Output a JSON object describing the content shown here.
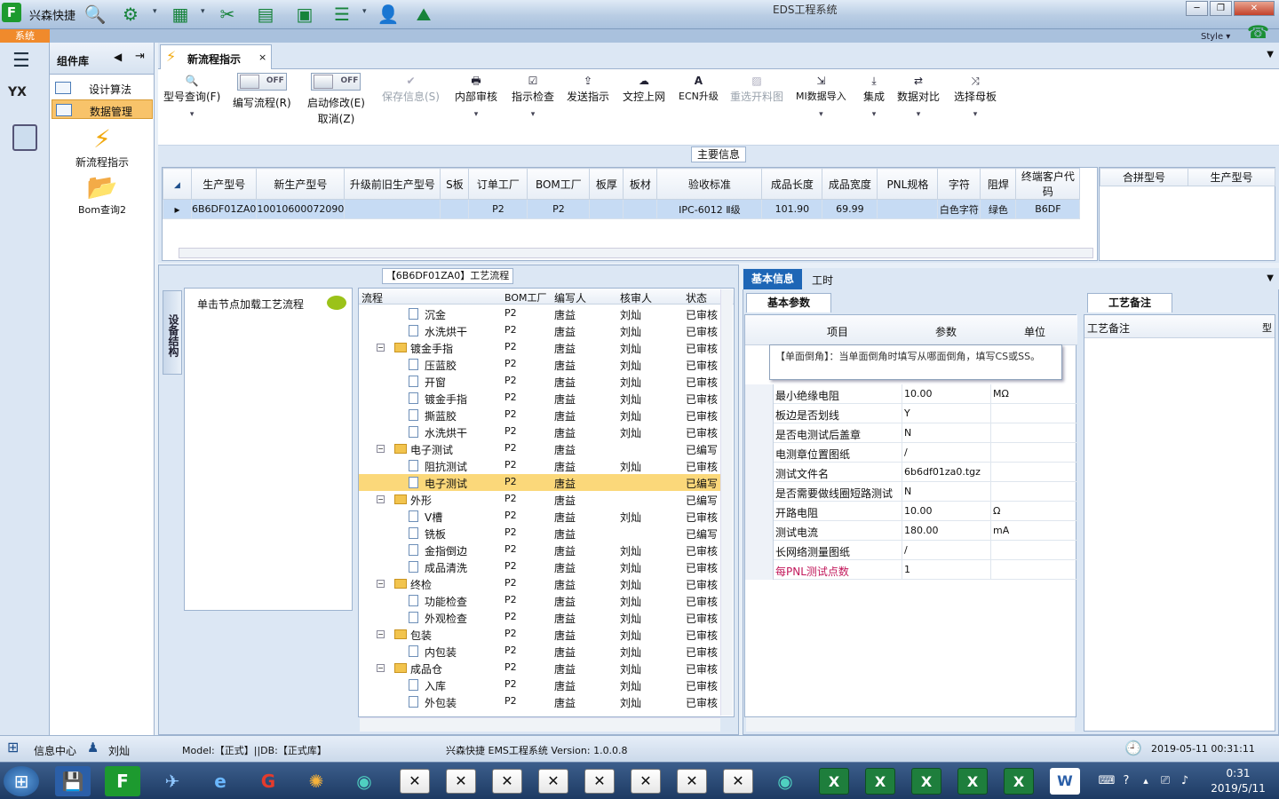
{
  "titlebar": {
    "app_name": "兴森快捷",
    "window_title": "EDS工程系统",
    "min": "─",
    "max": "❐",
    "close": "✕"
  },
  "ribbon": {
    "system_tab": "系统",
    "style_label": "Style ▾"
  },
  "component_panel": {
    "title": "组件库",
    "items": [
      {
        "label": "设计算法"
      },
      {
        "label": "数据管理"
      }
    ],
    "big_items": [
      {
        "label": "新流程指示"
      },
      {
        "label": "Bom查询2"
      }
    ]
  },
  "doc_tab": {
    "label": "新流程指示",
    "close": "×"
  },
  "toolbar": {
    "model_query": "型号查询(F)",
    "toggle_off": "OFF",
    "write_flow": "编写流程(R)",
    "start_modify": "启动修改(E)",
    "cancel": "取消(Z)",
    "save_info": "保存信息(S)",
    "internal_review": "内部审核",
    "instruction_check": "指示检查",
    "send_instruction": "发送指示",
    "doc_upload": "文控上网",
    "ecn_upgrade": "ECN升级",
    "reselect_material": "重选开料图",
    "mi_import": "MI数据导入",
    "integrate": "集成",
    "data_compare": "数据对比",
    "select_mother": "选择母板"
  },
  "main_info": {
    "caption": "主要信息",
    "columns": [
      "生产型号",
      "新生产型号",
      "升级前旧生产型号",
      "S板",
      "订单工厂",
      "BOM工厂",
      "板厚",
      "板材",
      "验收标准",
      "成品长度",
      "成品宽度",
      "PNL规格",
      "字符",
      "阻焊",
      "终端客户代码"
    ],
    "row": [
      "6B6DF01ZA0",
      "10010600072090",
      "",
      "",
      "P2",
      "P2",
      "",
      "",
      "IPC-6012 Ⅱ级",
      "101.90",
      "69.99",
      "",
      "白色字符",
      "绿色",
      "B6DF"
    ],
    "side_columns": [
      "合拼型号",
      "生产型号"
    ]
  },
  "process": {
    "caption": "【6B6DF01ZA0】工艺流程",
    "side_tab": "设备结构",
    "hint": "单击节点加载工艺流程",
    "columns": [
      "流程",
      "BOM工厂",
      "编写人",
      "核审人",
      "状态"
    ],
    "rows": [
      {
        "name": "沉金",
        "level": 2,
        "bom": "P2",
        "writer": "唐益",
        "reviewer": "刘灿",
        "status": "已审核"
      },
      {
        "name": "水洗烘干",
        "level": 2,
        "bom": "P2",
        "writer": "唐益",
        "reviewer": "刘灿",
        "status": "已审核"
      },
      {
        "name": "镀金手指",
        "level": 1,
        "bom": "P2",
        "writer": "唐益",
        "reviewer": "刘灿",
        "status": "已审核"
      },
      {
        "name": "压蓝胶",
        "level": 2,
        "bom": "P2",
        "writer": "唐益",
        "reviewer": "刘灿",
        "status": "已审核"
      },
      {
        "name": "开窗",
        "level": 2,
        "bom": "P2",
        "writer": "唐益",
        "reviewer": "刘灿",
        "status": "已审核"
      },
      {
        "name": "镀金手指",
        "level": 2,
        "bom": "P2",
        "writer": "唐益",
        "reviewer": "刘灿",
        "status": "已审核"
      },
      {
        "name": "撕蓝胶",
        "level": 2,
        "bom": "P2",
        "writer": "唐益",
        "reviewer": "刘灿",
        "status": "已审核"
      },
      {
        "name": "水洗烘干",
        "level": 2,
        "bom": "P2",
        "writer": "唐益",
        "reviewer": "刘灿",
        "status": "已审核"
      },
      {
        "name": "电子测试",
        "level": 1,
        "bom": "P2",
        "writer": "唐益",
        "reviewer": "",
        "status": "已编写"
      },
      {
        "name": "阻抗测试",
        "level": 2,
        "bom": "P2",
        "writer": "唐益",
        "reviewer": "刘灿",
        "status": "已审核"
      },
      {
        "name": "电子测试",
        "level": 2,
        "bom": "P2",
        "writer": "唐益",
        "reviewer": "",
        "status": "已编写",
        "selected": true
      },
      {
        "name": "外形",
        "level": 1,
        "bom": "P2",
        "writer": "唐益",
        "reviewer": "",
        "status": "已编写"
      },
      {
        "name": "V槽",
        "level": 2,
        "bom": "P2",
        "writer": "唐益",
        "reviewer": "刘灿",
        "status": "已审核"
      },
      {
        "name": "铣板",
        "level": 2,
        "bom": "P2",
        "writer": "唐益",
        "reviewer": "",
        "status": "已编写"
      },
      {
        "name": "金指倒边",
        "level": 2,
        "bom": "P2",
        "writer": "唐益",
        "reviewer": "刘灿",
        "status": "已审核"
      },
      {
        "name": "成品清洗",
        "level": 2,
        "bom": "P2",
        "writer": "唐益",
        "reviewer": "刘灿",
        "status": "已审核"
      },
      {
        "name": "终检",
        "level": 1,
        "bom": "P2",
        "writer": "唐益",
        "reviewer": "刘灿",
        "status": "已审核"
      },
      {
        "name": "功能检查",
        "level": 2,
        "bom": "P2",
        "writer": "唐益",
        "reviewer": "刘灿",
        "status": "已审核"
      },
      {
        "name": "外观检查",
        "level": 2,
        "bom": "P2",
        "writer": "唐益",
        "reviewer": "刘灿",
        "status": "已审核"
      },
      {
        "name": "包装",
        "level": 1,
        "bom": "P2",
        "writer": "唐益",
        "reviewer": "刘灿",
        "status": "已审核"
      },
      {
        "name": "内包装",
        "level": 2,
        "bom": "P2",
        "writer": "唐益",
        "reviewer": "刘灿",
        "status": "已审核"
      },
      {
        "name": "成品仓",
        "level": 1,
        "bom": "P2",
        "writer": "唐益",
        "reviewer": "刘灿",
        "status": "已审核"
      },
      {
        "name": "入库",
        "level": 2,
        "bom": "P2",
        "writer": "唐益",
        "reviewer": "刘灿",
        "status": "已审核"
      },
      {
        "name": "外包装",
        "level": 2,
        "bom": "P2",
        "writer": "唐益",
        "reviewer": "刘灿",
        "status": "已审核"
      }
    ]
  },
  "right_panel": {
    "tabs": [
      "基本信息",
      "工时"
    ],
    "sub_tab": "基本参数",
    "columns": [
      "项目",
      "参数",
      "单位"
    ],
    "tooltip": "【单面倒角】：当单面倒角时填写从哪面倒角，填写CS或SS。",
    "params": [
      {
        "item": "最小绝缘电阻",
        "value": "10.00",
        "unit": "MΩ"
      },
      {
        "item": "板边是否划线",
        "value": "Y",
        "unit": ""
      },
      {
        "item": "是否电测试后盖章",
        "value": "N",
        "unit": ""
      },
      {
        "item": "电测章位置图纸",
        "value": "/",
        "unit": ""
      },
      {
        "item": "测试文件名",
        "value": "6b6df01za0.tgz",
        "unit": ""
      },
      {
        "item": "是否需要做线圈短路测试",
        "value": "N",
        "unit": ""
      },
      {
        "item": "开路电阻",
        "value": "10.00",
        "unit": "Ω"
      },
      {
        "item": "测试电流",
        "value": "180.00",
        "unit": "mA"
      },
      {
        "item": "长网络测量图纸",
        "value": "/",
        "unit": ""
      },
      {
        "item": "每PNL测试点数",
        "value": "1",
        "unit": "",
        "pink": true
      }
    ],
    "remark_tab": "工艺备注",
    "remark_col": "工艺备注",
    "remark_extra": "型"
  },
  "statusbar": {
    "info_center": "信息中心",
    "user": "刘灿",
    "model": "Model:【正式】||DB:【正式库】",
    "version": "兴森快捷  EMS工程系统  Version: 1.0.0.8",
    "datetime": "2019-05-11  00:31:11"
  },
  "taskbar": {
    "time": "0:31",
    "date": "2019/5/11"
  }
}
